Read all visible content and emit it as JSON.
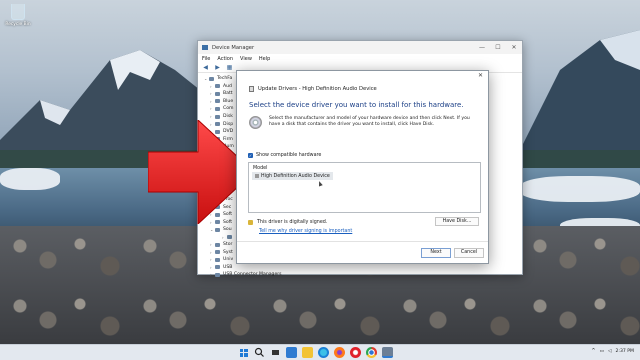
{
  "desktop": {
    "recycle_bin_label": "Recycle Bin"
  },
  "device_manager": {
    "title": "Device Manager",
    "menu": [
      "File",
      "Action",
      "View",
      "Help"
    ],
    "window_controls": [
      "—",
      "☐",
      "✕"
    ],
    "tree_items": [
      "TechFa",
      "Aud",
      "Batt",
      "Blue",
      "Com",
      "Disk",
      "Disp",
      "DVD",
      "Firm",
      "Hum",
      "IDE",
      "Keyb",
      "Mice",
      "Mon",
      "Netw",
      "Prin",
      "Proc",
      "Sec",
      "Soft",
      "Soft",
      "Sou",
      "",
      "Stor",
      "Syst",
      "Univ",
      "USB",
      "USB Connector Managers"
    ]
  },
  "dialog": {
    "header": "Update Drivers - High Definition Audio Device",
    "heading": "Select the device driver you want to install for this hardware.",
    "description": "Select the manufacturer and model of your hardware device and then click Next. If you have a disk that contains the driver you want to install, click Have Disk.",
    "show_compatible_label": "Show compatible hardware",
    "show_compatible_checked": true,
    "model_header": "Model",
    "models": [
      "High Definition Audio Device"
    ],
    "signed_text": "This driver is digitally signed.",
    "signing_link": "Tell me why driver signing is important",
    "have_disk_label": "Have Disk...",
    "next_label": "Next",
    "cancel_label": "Cancel",
    "close_glyph": "✕"
  },
  "taskbar": {
    "time": "2:37 PM",
    "apps": [
      "start-icon",
      "search-icon",
      "task-view-icon",
      "widgets-icon",
      "file-explorer-icon",
      "edge-icon",
      "firefox-icon",
      "opera-icon",
      "chrome-icon",
      "device-manager-icon"
    ]
  },
  "colors": {
    "accent": "#1f5fb5",
    "link": "#1a5fbf",
    "heading": "#1b3f86",
    "arrow": "#e02020"
  }
}
